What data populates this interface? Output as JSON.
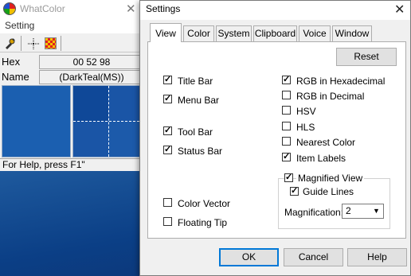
{
  "whatcolor": {
    "title": "WhatColor",
    "menu": [
      "Setting"
    ],
    "hex_label": "Hex",
    "hex_value": "00 52 98",
    "name_label": "Name",
    "name_value": "(DarkTeal(MS))",
    "status": "For Help, press F1\""
  },
  "settings": {
    "title": "Settings",
    "close_glyph": "✕",
    "tabs": [
      "View",
      "Color",
      "System",
      "Clipboard",
      "Voice",
      "Window"
    ],
    "active_tab": "View",
    "reset_label": "Reset",
    "left_options": [
      {
        "label": "Title Bar",
        "checked": true
      },
      {
        "label": "Menu Bar",
        "checked": true
      },
      {
        "label": "Tool Bar",
        "checked": true
      },
      {
        "label": "Status Bar",
        "checked": true
      },
      {
        "label": "Color Vector",
        "checked": false
      },
      {
        "label": "Floating Tip",
        "checked": false
      }
    ],
    "right_options": [
      {
        "label": "RGB in Hexadecimal",
        "checked": true
      },
      {
        "label": "RGB in Decimal",
        "checked": false
      },
      {
        "label": "HSV",
        "checked": false
      },
      {
        "label": "HLS",
        "checked": false
      },
      {
        "label": "Nearest Color",
        "checked": false
      },
      {
        "label": "Item Labels",
        "checked": true
      }
    ],
    "magnified_view": {
      "label": "Magnified View",
      "checked": true
    },
    "guide_lines": {
      "label": "Guide Lines",
      "checked": true
    },
    "magnification_label": "Magnification:",
    "magnification_value": "2",
    "ok_label": "OK",
    "cancel_label": "Cancel",
    "help_label": "Help"
  },
  "colors": {
    "swatch": "#1b5fb0",
    "accent": "#0078d7"
  }
}
